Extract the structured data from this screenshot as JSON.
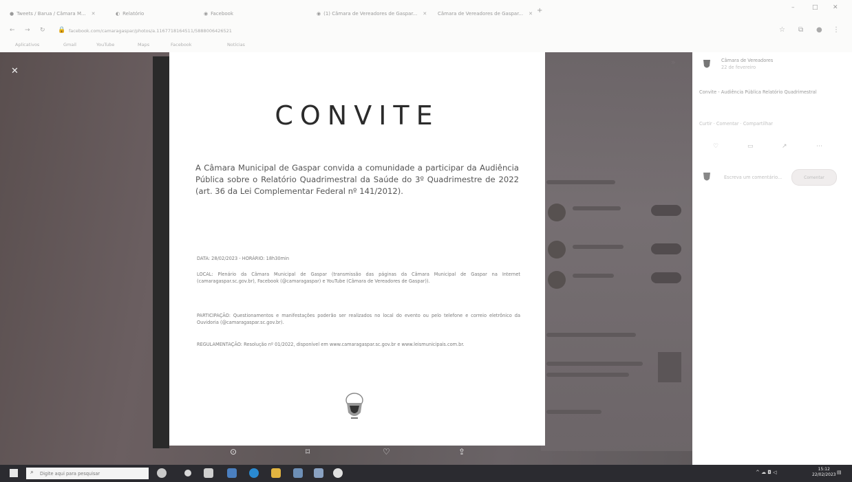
{
  "browser": {
    "tabs": [
      {
        "label": "Tweets / Barua / Câmara M..."
      },
      {
        "label": "Relatório"
      },
      {
        "label": "Facebook"
      },
      {
        "label": "(1) Câmara de Vereadores de Gaspar..."
      },
      {
        "label": "Câmara de Vereadores de Gaspar..."
      }
    ],
    "url": "facebook.com/camaragaspar/photos/a.1167718164511/5888006426521",
    "bookmarks": [
      "Aplicativos",
      "Gmail",
      "YouTube",
      "Maps",
      "Facebook",
      "Notícias"
    ]
  },
  "document": {
    "title": "CONVITE",
    "intro": "A Câmara Municipal de Gaspar convida a comunidade a participar da Audiência Pública sobre o Relatório Quadrimestral da Saúde do 3º Quadrimestre de 2022 (art. 36 da Lei Complementar Federal nº 141/2012).",
    "data_line": "DATA: 28/02/2023 - HORÁRIO: 18h30min",
    "local": "LOCAL: Plenário da Câmara Municipal de Gaspar (transmissão das páginas da Câmara Municipal de Gaspar na Internet (camaragaspar.sc.gov.br), Facebook (@camaragaspar) e YouTube (Câmara de Vereadores de Gaspar)).",
    "participacao": "PARTICIPAÇÃO: Questionamentos e manifestações poderão ser realizados no local do evento ou pelo telefone e correio eletrônico da Ouvidoria (@camaragaspar.sc.gov.br).",
    "regulamentacao": "REGULAMENTAÇÃO: Resolução nº 01/2022, disponível em www.camaragaspar.sc.gov.br e www.leismunicipais.com.br."
  },
  "sidebar": {
    "page_name": "Câmara de Vereadores",
    "page_sub": "22 de fevereiro",
    "post_text": "Convite - Audiência Pública Relatório Quadrimestral",
    "reactions_text": "Curtir · Comentar · Compartilhar",
    "comment_placeholder": "Escreva um comentário...",
    "comment_button": "Comentar"
  },
  "taskbar": {
    "search_placeholder": "Digite aqui para pesquisar",
    "clock_time": "15:12",
    "clock_date": "22/02/2023"
  },
  "colors": {
    "viewer_bg": "#5f5a5c",
    "taskbar_bg": "#2b2b30",
    "page_bg": "#ffffff"
  }
}
